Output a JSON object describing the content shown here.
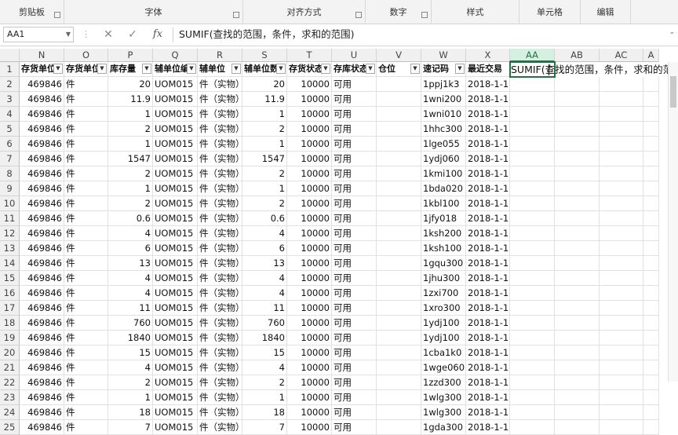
{
  "ribbon": {
    "groups": [
      {
        "label": "剪贴板",
        "launcher": true
      },
      {
        "label": "字体",
        "launcher": true
      },
      {
        "label": "对齐方式",
        "launcher": true
      },
      {
        "label": "数字",
        "launcher": true
      },
      {
        "label": "样式",
        "launcher": false
      },
      {
        "label": "单元格",
        "launcher": false
      },
      {
        "label": "编辑",
        "launcher": false
      }
    ]
  },
  "formula_bar": {
    "name_box": "AA1",
    "cancel_icon": "✕",
    "enter_icon": "✓",
    "fx_label": "fx",
    "content": "SUMIF(查找的范围，条件，求和的范围)"
  },
  "sheet": {
    "columns": [
      "N",
      "O",
      "P",
      "Q",
      "R",
      "S",
      "T",
      "U",
      "V",
      "W",
      "X",
      "AA",
      "AB",
      "AC",
      "A"
    ],
    "selected_column": "AA",
    "header_row": [
      "存货单位",
      "存货单位",
      "库存量",
      "辅单位编",
      "辅单位",
      "辅单位数",
      "存货状态",
      "存库状态",
      "仓位",
      "速记码",
      "最近交易",
      "",
      "",
      "",
      ""
    ],
    "editing_text": "SUMIF(查找的范围，条件，求和的范围",
    "rows": [
      {
        "n": "2",
        "N": "469846",
        "O": "件",
        "P": "20",
        "Q": "UOM015",
        "R": "件（实物）",
        "S": "20",
        "T": "10000",
        "U": "可用",
        "W": "1ppj1k3",
        "X": "2018-1-1"
      },
      {
        "n": "3",
        "N": "469846",
        "O": "件",
        "P": "11.9",
        "Q": "UOM015",
        "R": "件（实物）",
        "S": "11.9",
        "T": "10000",
        "U": "可用",
        "W": "1wni200",
        "X": "2018-1-1"
      },
      {
        "n": "4",
        "N": "469846",
        "O": "件",
        "P": "1",
        "Q": "UOM015",
        "R": "件（实物）",
        "S": "1",
        "T": "10000",
        "U": "可用",
        "W": "1wni010",
        "X": "2018-1-1"
      },
      {
        "n": "5",
        "N": "469846",
        "O": "件",
        "P": "2",
        "Q": "UOM015",
        "R": "件（实物）",
        "S": "2",
        "T": "10000",
        "U": "可用",
        "W": "1hhc300",
        "X": "2018-1-1"
      },
      {
        "n": "6",
        "N": "469846",
        "O": "件",
        "P": "1",
        "Q": "UOM015",
        "R": "件（实物）",
        "S": "1",
        "T": "10000",
        "U": "可用",
        "W": "1lge055",
        "X": "2018-1-1"
      },
      {
        "n": "7",
        "N": "469846",
        "O": "件",
        "P": "1547",
        "Q": "UOM015",
        "R": "件（实物）",
        "S": "1547",
        "T": "10000",
        "U": "可用",
        "W": "1ydj060",
        "X": "2018-1-1"
      },
      {
        "n": "8",
        "N": "469846",
        "O": "件",
        "P": "2",
        "Q": "UOM015",
        "R": "件（实物）",
        "S": "2",
        "T": "10000",
        "U": "可用",
        "W": "1kmi100",
        "X": "2018-1-1"
      },
      {
        "n": "9",
        "N": "469846",
        "O": "件",
        "P": "1",
        "Q": "UOM015",
        "R": "件（实物）",
        "S": "1",
        "T": "10000",
        "U": "可用",
        "W": "1bda020",
        "X": "2018-1-1"
      },
      {
        "n": "10",
        "N": "469846",
        "O": "件",
        "P": "2",
        "Q": "UOM015",
        "R": "件（实物）",
        "S": "2",
        "T": "10000",
        "U": "可用",
        "W": "1kbl100",
        "X": "2018-1-1"
      },
      {
        "n": "11",
        "N": "469846",
        "O": "件",
        "P": "0.6",
        "Q": "UOM015",
        "R": "件（实物）",
        "S": "0.6",
        "T": "10000",
        "U": "可用",
        "W": "1jfy018",
        "X": "2018-1-1"
      },
      {
        "n": "12",
        "N": "469846",
        "O": "件",
        "P": "4",
        "Q": "UOM015",
        "R": "件（实物）",
        "S": "4",
        "T": "10000",
        "U": "可用",
        "W": "1ksh200",
        "X": "2018-1-1"
      },
      {
        "n": "13",
        "N": "469846",
        "O": "件",
        "P": "6",
        "Q": "UOM015",
        "R": "件（实物）",
        "S": "6",
        "T": "10000",
        "U": "可用",
        "W": "1ksh100",
        "X": "2018-1-1"
      },
      {
        "n": "14",
        "N": "469846",
        "O": "件",
        "P": "13",
        "Q": "UOM015",
        "R": "件（实物）",
        "S": "13",
        "T": "10000",
        "U": "可用",
        "W": "1gqu300",
        "X": "2018-1-1"
      },
      {
        "n": "15",
        "N": "469846",
        "O": "件",
        "P": "4",
        "Q": "UOM015",
        "R": "件（实物）",
        "S": "4",
        "T": "10000",
        "U": "可用",
        "W": "1jhu300",
        "X": "2018-1-1"
      },
      {
        "n": "16",
        "N": "469846",
        "O": "件",
        "P": "4",
        "Q": "UOM015",
        "R": "件（实物）",
        "S": "4",
        "T": "10000",
        "U": "可用",
        "W": "1zxi700",
        "X": "2018-1-1"
      },
      {
        "n": "17",
        "N": "469846",
        "O": "件",
        "P": "11",
        "Q": "UOM015",
        "R": "件（实物）",
        "S": "11",
        "T": "10000",
        "U": "可用",
        "W": "1xro300",
        "X": "2018-1-1"
      },
      {
        "n": "18",
        "N": "469846",
        "O": "件",
        "P": "760",
        "Q": "UOM015",
        "R": "件（实物）",
        "S": "760",
        "T": "10000",
        "U": "可用",
        "W": "1ydj100",
        "X": "2018-1-1"
      },
      {
        "n": "19",
        "N": "469846",
        "O": "件",
        "P": "1840",
        "Q": "UOM015",
        "R": "件（实物）",
        "S": "1840",
        "T": "10000",
        "U": "可用",
        "W": "1ydj100",
        "X": "2018-1-1"
      },
      {
        "n": "20",
        "N": "469846",
        "O": "件",
        "P": "15",
        "Q": "UOM015",
        "R": "件（实物）",
        "S": "15",
        "T": "10000",
        "U": "可用",
        "W": "1cba1k0",
        "X": "2018-1-1"
      },
      {
        "n": "21",
        "N": "469846",
        "O": "件",
        "P": "4",
        "Q": "UOM015",
        "R": "件（实物）",
        "S": "4",
        "T": "10000",
        "U": "可用",
        "W": "1wge060",
        "X": "2018-1-1"
      },
      {
        "n": "22",
        "N": "469846",
        "O": "件",
        "P": "2",
        "Q": "UOM015",
        "R": "件（实物）",
        "S": "2",
        "T": "10000",
        "U": "可用",
        "W": "1zzd300",
        "X": "2018-1-1"
      },
      {
        "n": "23",
        "N": "469846",
        "O": "件",
        "P": "1",
        "Q": "UOM015",
        "R": "件（实物）",
        "S": "1",
        "T": "10000",
        "U": "可用",
        "W": "1wlg300",
        "X": "2018-1-1"
      },
      {
        "n": "24",
        "N": "469846",
        "O": "件",
        "P": "18",
        "Q": "UOM015",
        "R": "件（实物）",
        "S": "18",
        "T": "10000",
        "U": "可用",
        "W": "1wlg300",
        "X": "2018-1-1"
      },
      {
        "n": "25",
        "N": "469846",
        "O": "件",
        "P": "7",
        "Q": "UOM015",
        "R": "件（实物）",
        "S": "7",
        "T": "10000",
        "U": "可用",
        "W": "1gda300",
        "X": "2018-1-1"
      }
    ]
  },
  "colors": {
    "accent": "#217346",
    "selected_header_bg": "#d3f0e0"
  }
}
